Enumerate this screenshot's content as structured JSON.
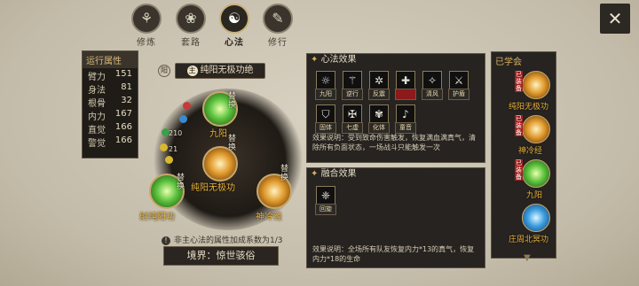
{
  "tabs": [
    {
      "label": "修炼",
      "icon": "training-icon"
    },
    {
      "label": "套路",
      "icon": "routine-icon"
    },
    {
      "label": "心法",
      "icon": "yinyang-icon"
    },
    {
      "label": "修行",
      "icon": "practice-icon"
    }
  ],
  "attributes": {
    "title": "运行属性",
    "rows": [
      {
        "name": "臂力",
        "value": "151"
      },
      {
        "name": "身法",
        "value": "81"
      },
      {
        "name": "根骨",
        "value": "32"
      },
      {
        "name": "内力",
        "value": "167"
      },
      {
        "name": "直觉",
        "value": "166"
      },
      {
        "name": "警觉",
        "value": "166"
      }
    ]
  },
  "main": {
    "yin_label": "阳",
    "main_marker": "主",
    "main_title": "纯阳无极功绝",
    "dot_values": [
      "210",
      "21"
    ],
    "skills": [
      {
        "name": "九阳",
        "swap": "替换"
      },
      {
        "name": "纯阳无极功",
        "swap": "替换"
      },
      {
        "name": "射纯阳功",
        "swap": "替换"
      },
      {
        "name": "神冷经",
        "swap": "替换"
      }
    ],
    "note": "非主心法的属性加成系数为1/3",
    "realm": "境界：惊世骇俗"
  },
  "xinfa": {
    "title": "心法效果",
    "marks": [
      "九阳",
      "逆行",
      "反震",
      "",
      "清风",
      "护盾",
      "固体",
      "七虚",
      "化体",
      "童音"
    ],
    "description": "效果说明：受到致命伤害触发，恢复满血满真气，清除所有负面状态，一场战斗只能触发一次"
  },
  "fusion": {
    "title": "融合效果",
    "mark": "回旋",
    "description": "效果说明：全场所有队友恢复内力*13的真气，恢复内力*18的生命"
  },
  "learned": {
    "title": "已学会",
    "items": [
      {
        "name": "纯阳无极功",
        "tag": "已装备"
      },
      {
        "name": "神冷经",
        "tag": "已装备"
      },
      {
        "name": "九阳",
        "tag": "已装备"
      },
      {
        "name": "庄周北冥功",
        "tag": ""
      }
    ]
  }
}
